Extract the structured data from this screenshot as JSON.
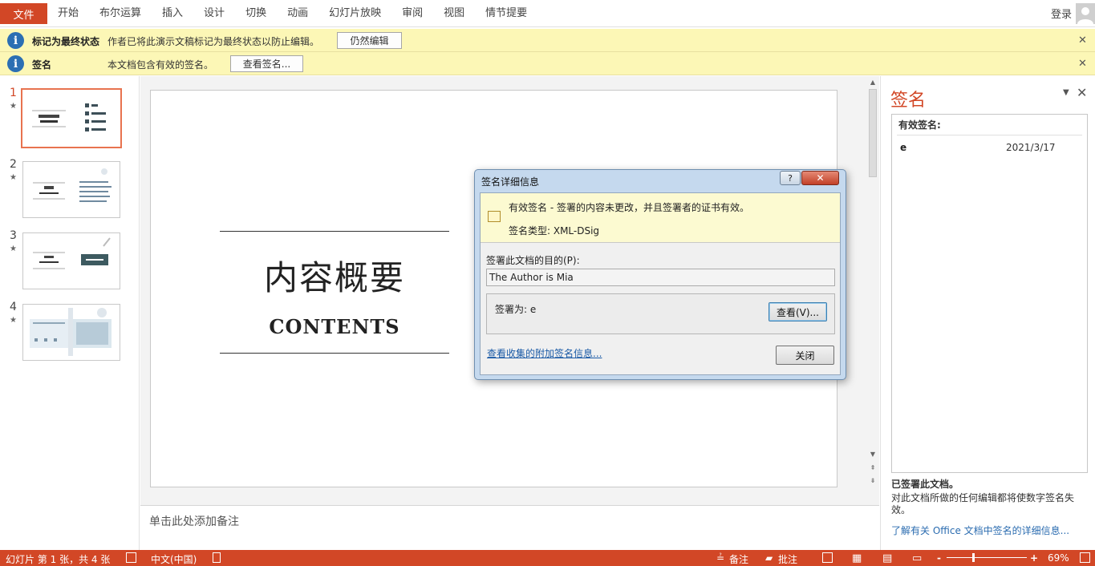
{
  "ribbon": {
    "file": "文件",
    "tabs": [
      "开始",
      "布尔运算",
      "插入",
      "设计",
      "切换",
      "动画",
      "幻灯片放映",
      "审阅",
      "视图",
      "情节提要"
    ],
    "login": "登录"
  },
  "msgbar1": {
    "title": "标记为最终状态",
    "text": "作者已将此演示文稿标记为最终状态以防止编辑。",
    "button": "仍然编辑",
    "close": "✕"
  },
  "msgbar2": {
    "title": "签名",
    "text": "本文档包含有效的签名。",
    "button": "查看签名...",
    "close": "✕"
  },
  "thumbnails": [
    {
      "num": "1",
      "star": "★"
    },
    {
      "num": "2",
      "star": "★"
    },
    {
      "num": "3",
      "star": "★"
    },
    {
      "num": "4",
      "star": "★"
    }
  ],
  "slide": {
    "title": "内容概要",
    "subtitle": "CONTENTS"
  },
  "notes": "单击此处添加备注",
  "sigpane": {
    "title": "签名",
    "valid_header": "有效签名:",
    "signer": "e",
    "date": "2021/3/17",
    "signed": "已签署此文档。",
    "warning": "对此文档所做的任何编辑都将使数字签名失效。",
    "link": "了解有关 Office 文档中签名的详细信息..."
  },
  "dialog": {
    "title": "签名详细信息",
    "help": "?",
    "close": "✕",
    "status": "有效签名 - 签署的内容未更改，并且签署者的证书有效。",
    "type": "签名类型: XML-DSig",
    "purpose_label": "签署此文档的目的(P):",
    "purpose_value": "The Author is Mia",
    "signer_label": "签署为:   e",
    "view_button": "查看(V)...",
    "more_link": "查看收集的附加签名信息...",
    "close_button": "关闭"
  },
  "statusbar": {
    "slide_info": "幻灯片 第 1 张，共 4 张",
    "language": "中文(中国)",
    "notes": "备注",
    "comments": "批注",
    "zoom": "69%"
  }
}
